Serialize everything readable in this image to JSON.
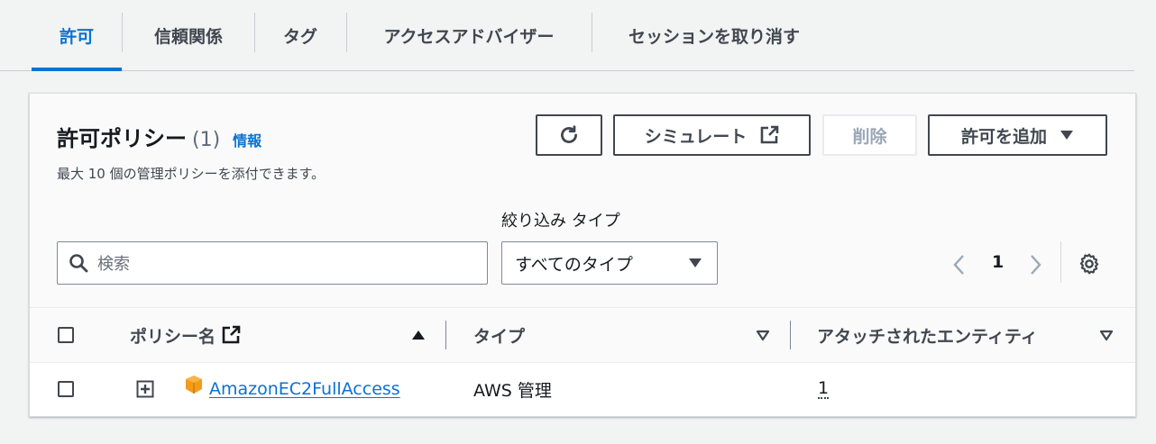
{
  "tabs": [
    {
      "label": "許可"
    },
    {
      "label": "信頼関係"
    },
    {
      "label": "タグ"
    },
    {
      "label": "アクセスアドバイザー"
    },
    {
      "label": "セッションを取り消す"
    }
  ],
  "panel": {
    "title": "許可ポリシー",
    "count": "(1)",
    "info_link": "情報",
    "description": "最大 10 個の管理ポリシーを添付できます。"
  },
  "actions": {
    "simulate": "シミュレート",
    "delete": "削除",
    "add_permission": "許可を追加"
  },
  "filters": {
    "search_placeholder": "検索",
    "type_label": "絞り込み タイプ",
    "type_value": "すべてのタイプ"
  },
  "pagination": {
    "current_page": "1"
  },
  "table": {
    "columns": {
      "policy_name": "ポリシー名",
      "type": "タイプ",
      "attached_entities": "アタッチされたエンティティ"
    },
    "rows": [
      {
        "policy_name": "AmazonEC2FullAccess",
        "type": "AWS 管理",
        "attached_entities": "1"
      }
    ]
  },
  "colors": {
    "accent": "#0972d3",
    "text": "#16191f",
    "secondary": "#414750",
    "aws_orange": "#f29c19"
  }
}
